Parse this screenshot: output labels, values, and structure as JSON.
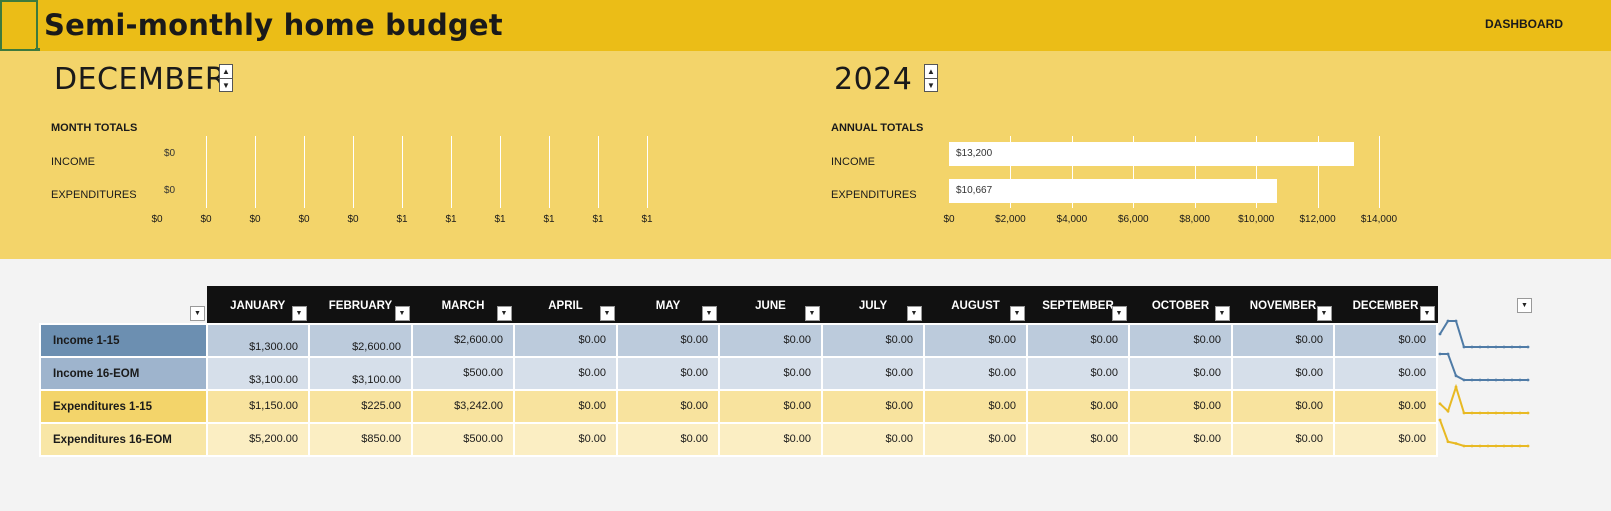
{
  "header": {
    "title": "Semi-monthly home budget",
    "dashboard_label": "DASHBOARD"
  },
  "selector": {
    "month": "DECEMBER",
    "year": "2024"
  },
  "month_totals": {
    "title": "MONTH TOTALS",
    "rows": [
      "INCOME",
      "EXPENDITURES"
    ],
    "values": [
      "$0",
      "$0"
    ],
    "ticks": [
      "$0",
      "$0",
      "$0",
      "$0",
      "$0",
      "$1",
      "$1",
      "$1",
      "$1",
      "$1",
      "$1"
    ]
  },
  "annual_totals": {
    "title": "ANNUAL TOTALS",
    "rows": [
      "INCOME",
      "EXPENDITURES"
    ],
    "values": [
      "$13,200",
      "$10,667"
    ],
    "ticks": [
      "$0",
      "$2,000",
      "$4,000",
      "$6,000",
      "$8,000",
      "$10,000",
      "$12,000",
      "$14,000"
    ]
  },
  "chart_data": [
    {
      "type": "bar",
      "title": "MONTH TOTALS",
      "categories": [
        "INCOME",
        "EXPENDITURES"
      ],
      "values": [
        0,
        0
      ],
      "xlim": [
        0,
        1
      ]
    },
    {
      "type": "bar",
      "title": "ANNUAL TOTALS",
      "categories": [
        "INCOME",
        "EXPENDITURES"
      ],
      "values": [
        13200,
        10667
      ],
      "xlim": [
        0,
        14000
      ]
    }
  ],
  "table": {
    "months": [
      "JANUARY",
      "FEBRUARY",
      "MARCH",
      "APRIL",
      "MAY",
      "JUNE",
      "JULY",
      "AUGUST",
      "SEPTEMBER",
      "OCTOBER",
      "NOVEMBER",
      "DECEMBER"
    ],
    "rows": [
      {
        "label": "Income 1-15",
        "values": [
          "$1,300.00",
          "$2,600.00",
          "$2,600.00",
          "$0.00",
          "$0.00",
          "$0.00",
          "$0.00",
          "$0.00",
          "$0.00",
          "$0.00",
          "$0.00",
          "$0.00"
        ],
        "numbers": [
          1300,
          2600,
          2600,
          0,
          0,
          0,
          0,
          0,
          0,
          0,
          0,
          0
        ]
      },
      {
        "label": "Income 16-EOM",
        "values": [
          "$3,100.00",
          "$3,100.00",
          "$500.00",
          "$0.00",
          "$0.00",
          "$0.00",
          "$0.00",
          "$0.00",
          "$0.00",
          "$0.00",
          "$0.00",
          "$0.00"
        ],
        "numbers": [
          3100,
          3100,
          500,
          0,
          0,
          0,
          0,
          0,
          0,
          0,
          0,
          0
        ]
      },
      {
        "label": "Expenditures 1-15",
        "values": [
          "$1,150.00",
          "$225.00",
          "$3,242.00",
          "$0.00",
          "$0.00",
          "$0.00",
          "$0.00",
          "$0.00",
          "$0.00",
          "$0.00",
          "$0.00",
          "$0.00"
        ],
        "numbers": [
          1150,
          225,
          3242,
          0,
          0,
          0,
          0,
          0,
          0,
          0,
          0,
          0
        ]
      },
      {
        "label": "Expenditures 16-EOM",
        "values": [
          "$5,200.00",
          "$850.00",
          "$500.00",
          "$0.00",
          "$0.00",
          "$0.00",
          "$0.00",
          "$0.00",
          "$0.00",
          "$0.00",
          "$0.00",
          "$0.00"
        ],
        "numbers": [
          5200,
          850,
          500,
          0,
          0,
          0,
          0,
          0,
          0,
          0,
          0,
          0
        ]
      }
    ]
  },
  "colors": {
    "income_spark": "#4f7ba6",
    "expense_spark": "#e8b923"
  },
  "icons": {
    "dropdown": "dropdown-arrow-icon",
    "spinner": "spinner-icon"
  }
}
